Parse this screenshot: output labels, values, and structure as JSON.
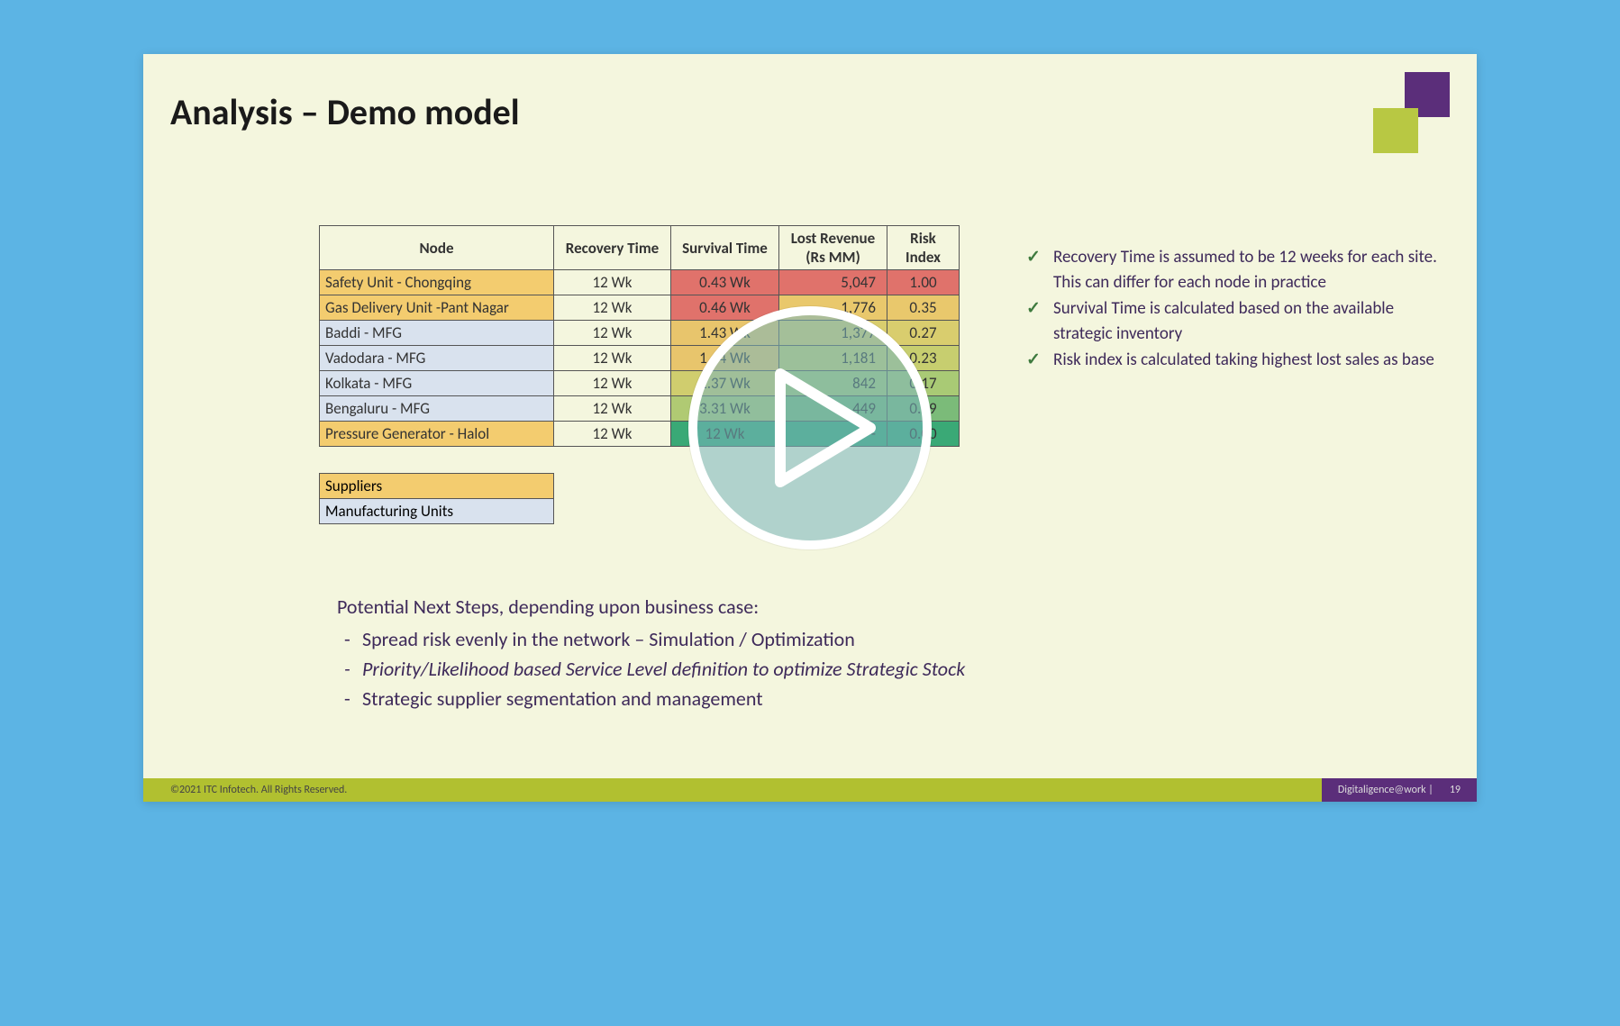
{
  "title": "Analysis – Demo model",
  "columns": {
    "node": "Node",
    "recovery": "Recovery Time",
    "survival": "Survival Time",
    "lost": "Lost Revenue (Rs MM)",
    "risk": "Risk Index"
  },
  "rows": [
    {
      "node": "Safety Unit - Chongqing",
      "node_bg": "#f3cc6f",
      "recovery": "12 Wk",
      "survival": "0.43 Wk",
      "surv_bg": "#e0726b",
      "lost": "5,047",
      "lost_bg": "#e0726b",
      "risk": "1.00",
      "risk_bg": "#e0726b"
    },
    {
      "node": "Gas Delivery Unit -Pant Nagar",
      "node_bg": "#f3cc6f",
      "recovery": "12 Wk",
      "survival": "0.46 Wk",
      "surv_bg": "#e0726b",
      "lost": "1,776",
      "lost_bg": "#e9c86c",
      "risk": "0.35",
      "risk_bg": "#e9c86c"
    },
    {
      "node": "Baddi - MFG",
      "node_bg": "#d9e2ee",
      "recovery": "12 Wk",
      "survival": "1.43 Wk",
      "surv_bg": "#e8c56c",
      "lost": "1,377",
      "lost_bg": "#d9cd6e",
      "risk": "0.27",
      "risk_bg": "#d9cd6e"
    },
    {
      "node": "Vadodara - MFG",
      "node_bg": "#d9e2ee",
      "recovery": "12 Wk",
      "survival": "1.64 Wk",
      "surv_bg": "#e8c56c",
      "lost": "1,181",
      "lost_bg": "#c7ce6f",
      "risk": "0.23",
      "risk_bg": "#c7ce6f"
    },
    {
      "node": "Kolkata - MFG",
      "node_bg": "#d9e2ee",
      "recovery": "12 Wk",
      "survival": "2.37 Wk",
      "surv_bg": "#d0cd6e",
      "lost": "842",
      "lost_bg": "#a9ca75",
      "risk": "0.17",
      "risk_bg": "#a9ca75"
    },
    {
      "node": "Bengaluru - MFG",
      "node_bg": "#d9e2ee",
      "recovery": "12 Wk",
      "survival": "3.31 Wk",
      "surv_bg": "#b0ca73",
      "lost": "449",
      "lost_bg": "#7bbb79",
      "risk": "0.09",
      "risk_bg": "#7bbb79"
    },
    {
      "node": "Pressure Generator - Halol",
      "node_bg": "#f3cc6f",
      "recovery": "12 Wk",
      "survival": "12 Wk",
      "surv_bg": "#3aa976",
      "lost": "-",
      "lost_bg": "#3aa976",
      "risk": "0.00",
      "risk_bg": "#3aa976"
    }
  ],
  "legend": {
    "suppliers": {
      "label": "Suppliers",
      "bg": "#f3cc6f"
    },
    "mfg": {
      "label": "Manufacturing Units",
      "bg": "#d9e2ee"
    }
  },
  "bullets": [
    "Recovery Time is assumed to be 12 weeks for each site. This can differ for each node in practice",
    "Survival Time  is calculated based on the available strategic inventory",
    "Risk index is calculated taking highest lost sales as base"
  ],
  "steps": {
    "header": "Potential Next Steps, depending upon business case:",
    "items": [
      {
        "text": "Spread risk evenly in the network – Simulation / Optimization",
        "italic": false
      },
      {
        "text": "Priority/Likelihood based Service Level definition to optimize Strategic Stock",
        "italic": true
      },
      {
        "text": "Strategic supplier segmentation and management",
        "italic": false
      }
    ]
  },
  "footer": {
    "copyright": "©2021 ITC Infotech. All Rights Reserved.",
    "brand": "Digitaligence@work |",
    "page": "19"
  },
  "chart_data": {
    "type": "table",
    "title": "Analysis – Demo model",
    "columns": [
      "Node",
      "Recovery Time (Wk)",
      "Survival Time (Wk)",
      "Lost Revenue (Rs MM)",
      "Risk Index"
    ],
    "rows": [
      [
        "Safety Unit - Chongqing",
        12,
        0.43,
        5047,
        1.0
      ],
      [
        "Gas Delivery Unit -Pant Nagar",
        12,
        0.46,
        1776,
        0.35
      ],
      [
        "Baddi - MFG",
        12,
        1.43,
        1377,
        0.27
      ],
      [
        "Vadodara - MFG",
        12,
        1.64,
        1181,
        0.23
      ],
      [
        "Kolkata - MFG",
        12,
        2.37,
        842,
        0.17
      ],
      [
        "Bengaluru - MFG",
        12,
        3.31,
        449,
        0.09
      ],
      [
        "Pressure Generator - Halol",
        12,
        12.0,
        0,
        0.0
      ]
    ]
  }
}
